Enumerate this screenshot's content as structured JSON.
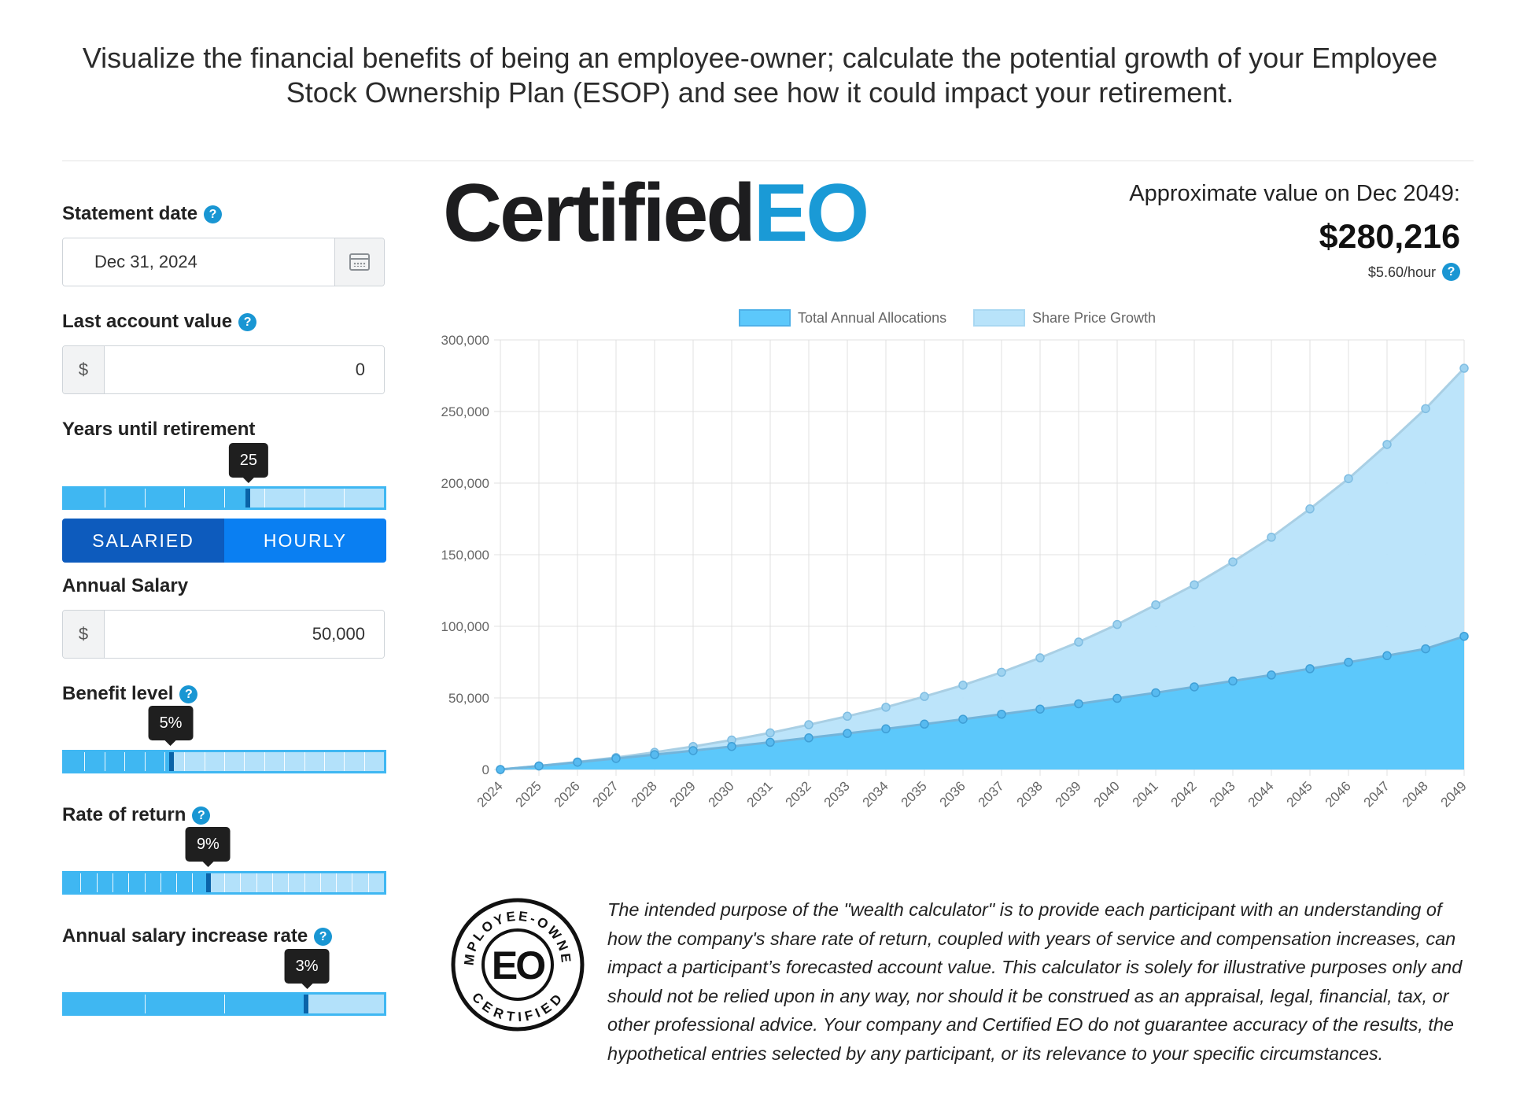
{
  "intro": "Visualize the financial benefits of being an employee-owner; calculate the potential growth of your Employee Stock Ownership Plan (ESOP) and see how it could impact your retirement.",
  "sidebar": {
    "statement_date": {
      "label": "Statement date",
      "help": "?",
      "value": "Dec 31, 2024",
      "icon": "calendar-icon"
    },
    "last_account_value": {
      "label": "Last account value",
      "help": "?",
      "prefix": "$",
      "value": "0"
    },
    "years_until_retirement": {
      "label": "Years until retirement",
      "value": 25,
      "value_label": "25",
      "fraction": 0.575
    },
    "pay_type": {
      "salaried": "SALARIED",
      "hourly": "HOURLY",
      "selected": "salaried"
    },
    "annual_salary": {
      "label": "Annual Salary",
      "prefix": "$",
      "value": "50,000"
    },
    "benefit_level": {
      "label": "Benefit level",
      "help": "?",
      "value_label": "5%",
      "fraction": 0.335
    },
    "rate_of_return": {
      "label": "Rate of return",
      "help": "?",
      "value_label": "9%",
      "fraction": 0.45
    },
    "salary_increase": {
      "label": "Annual salary increase rate",
      "help": "?",
      "value_label": "3%",
      "fraction": 0.755
    }
  },
  "logo": {
    "part1": "Certified",
    "part2": "EO"
  },
  "summary": {
    "label": "Approximate value on Dec 2049:",
    "value": "$280,216",
    "hourly": "$5.60/hour",
    "help": "?"
  },
  "seal": {
    "top_text": "EMPLOYEE-OWNED",
    "bottom_text": "CERTIFIED",
    "center": "EO"
  },
  "disclaimer": "The intended purpose of the \"wealth calculator\" is to provide each participant with an understanding of how the company's share rate of return, coupled with years of service and compensation increases, can impact a participant’s forecasted account value. This calculator is solely for illustrative purposes only and should not be relied upon in any way, nor should it be construed as an appraisal, legal, financial, tax, or other professional advice. Your company and Certified EO do not guarantee accuracy of the results, the hypothetical entries selected by any participant, or its relevance to your specific circumstances.",
  "colors": {
    "accent": "#1a9ad6",
    "series1": "#5cc8fb",
    "series2": "#b8e3fa",
    "toggle_on": "#0d5bbd",
    "toggle_off": "#0a7ff2"
  },
  "chart_data": {
    "type": "area",
    "stacked": true,
    "x": [
      "2024",
      "2025",
      "2026",
      "2027",
      "2028",
      "2029",
      "2030",
      "2031",
      "2032",
      "2033",
      "2034",
      "2035",
      "2036",
      "2037",
      "2038",
      "2039",
      "2040",
      "2041",
      "2042",
      "2043",
      "2044",
      "2045",
      "2046",
      "2047",
      "2048",
      "2049"
    ],
    "series": [
      {
        "name": "Total Annual Allocations",
        "values": [
          0,
          2500,
          5100,
          7700,
          10400,
          13200,
          16100,
          19000,
          22100,
          25200,
          28400,
          31700,
          35100,
          38600,
          42200,
          45900,
          49700,
          53600,
          57700,
          61800,
          66000,
          70400,
          74900,
          79500,
          84300,
          93000
        ]
      },
      {
        "name": "Share Price Growth",
        "values": [
          0,
          0,
          200,
          700,
          1600,
          2900,
          4500,
          6600,
          9200,
          12000,
          15100,
          19300,
          23800,
          29300,
          35800,
          43100,
          51600,
          61400,
          71300,
          83200,
          96200,
          111600,
          128200,
          147500,
          167700,
          187216
        ]
      }
    ],
    "totals": [
      0,
      2500,
      5300,
      8400,
      12000,
      16100,
      20600,
      25600,
      31300,
      37200,
      43500,
      51000,
      58900,
      67900,
      78000,
      89000,
      101300,
      115000,
      129000,
      145000,
      162200,
      182000,
      203100,
      227000,
      252000,
      280216
    ],
    "ylim": [
      0,
      300000
    ],
    "yticks": [
      "0",
      "50,000",
      "100,000",
      "150,000",
      "200,000",
      "250,000",
      "300,000"
    ],
    "legend": "top",
    "grid": true
  }
}
